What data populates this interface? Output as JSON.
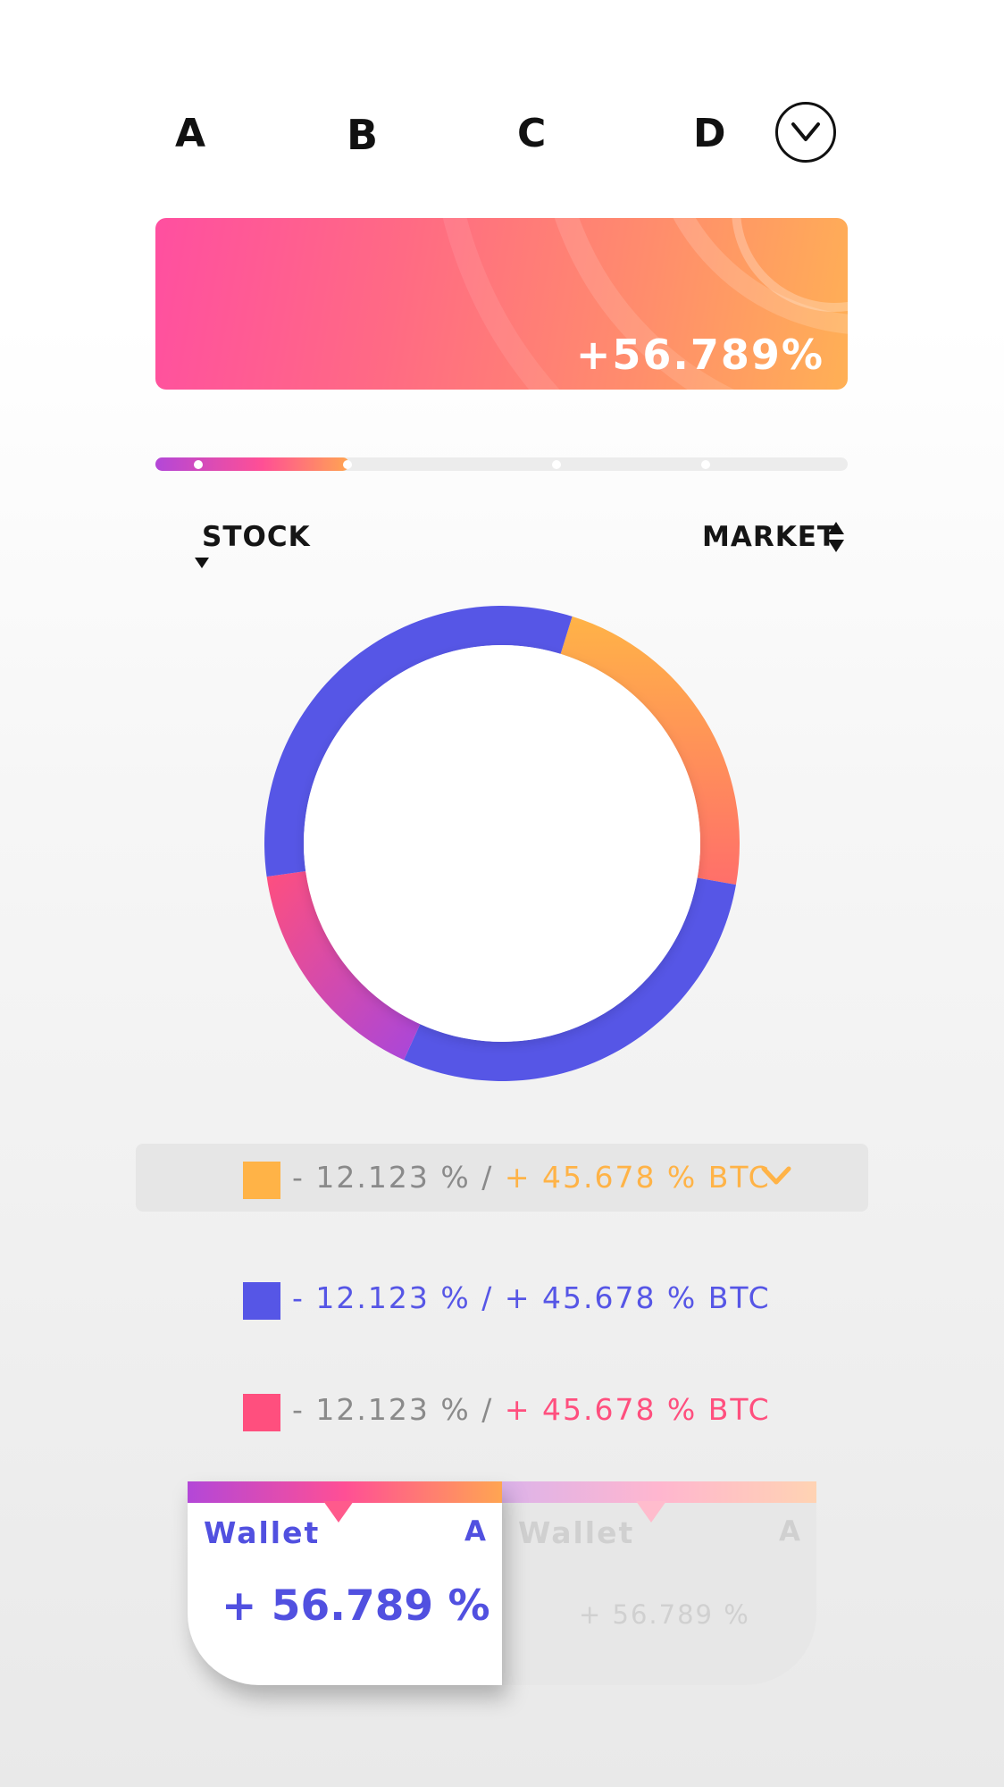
{
  "tabs": {
    "items": [
      {
        "label": "A"
      },
      {
        "label": "B",
        "active": true
      },
      {
        "label": "C"
      },
      {
        "label": "D"
      }
    ],
    "dropdown_icon": "chevron-down-icon"
  },
  "banner": {
    "value": "+56.789%"
  },
  "progress": {
    "fraction": 0.28,
    "step_markers": 4
  },
  "sort": {
    "left_label": "STOCK",
    "right_label": "MARKET"
  },
  "colors": {
    "orange": "#ffb347",
    "blue": "#5656e6",
    "pink": "#ff4f7e",
    "purple": "#b347d8",
    "gray": "#8a8a8a"
  },
  "chart_data": {
    "type": "pie",
    "style": "donut",
    "segments": [
      {
        "series": "orange",
        "share": 0.23
      },
      {
        "series": "blue",
        "share": 0.29
      },
      {
        "series": "pink-purple",
        "share": 0.16
      },
      {
        "series": "blue",
        "share": 0.32
      }
    ]
  },
  "legend": [
    {
      "neg": "- 12.123 %",
      "sep": " / ",
      "pos": "+ 45.678 % BTC",
      "color": "orange",
      "selected": true,
      "expand_icon": "chevron-down-icon"
    },
    {
      "neg": "- 12.123 %",
      "sep": " / ",
      "pos": "+ 45.678 % BTC",
      "color": "blue",
      "selected": false
    },
    {
      "neg": "- 12.123 %",
      "sep": " / ",
      "pos": "+ 45.678 % BTC",
      "color": "pink",
      "selected": false
    }
  ],
  "wallets": [
    {
      "name": "Wallet",
      "letter": "A",
      "value": "+ 56.789 %",
      "active": true
    },
    {
      "name": "Wallet",
      "letter": "A",
      "value": "+ 56.789 %",
      "active": false
    }
  ]
}
